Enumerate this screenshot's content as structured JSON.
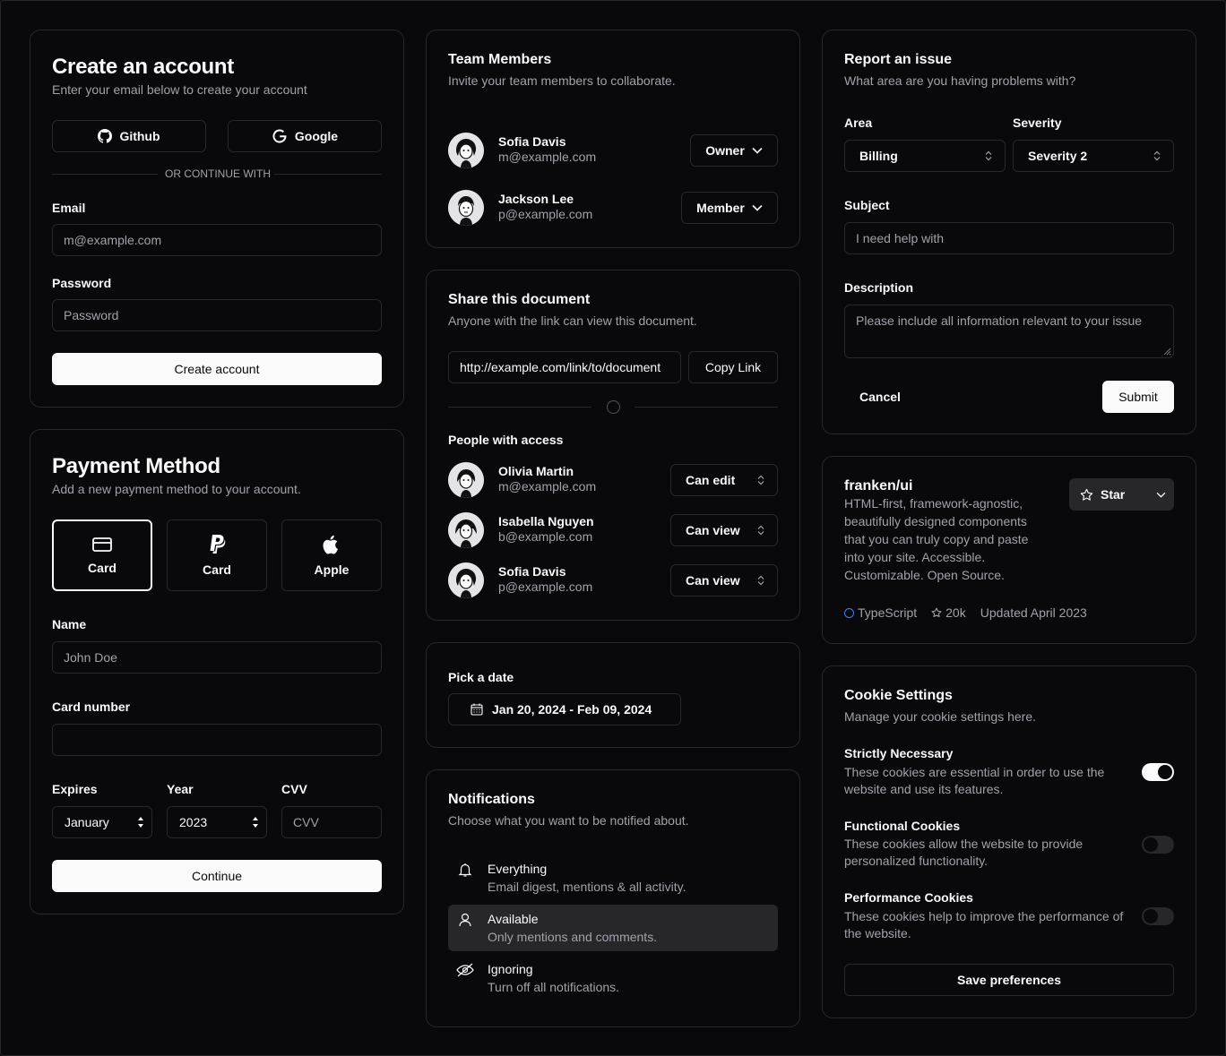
{
  "create_account": {
    "title": "Create an account",
    "subtitle": "Enter your email below to create your account",
    "github_label": "Github",
    "google_label": "Google",
    "divider_text": "OR CONTINUE WITH",
    "email_label": "Email",
    "email_placeholder": "m@example.com",
    "password_label": "Password",
    "password_placeholder": "Password",
    "submit_label": "Create account"
  },
  "payment": {
    "title": "Payment Method",
    "subtitle": "Add a new payment method to your account.",
    "options": [
      {
        "label": "Card",
        "icon": "credit-card-icon",
        "selected": true
      },
      {
        "label": "Card",
        "icon": "paypal-icon",
        "selected": false
      },
      {
        "label": "Apple",
        "icon": "apple-icon",
        "selected": false
      }
    ],
    "name_label": "Name",
    "name_placeholder": "John Doe",
    "card_number_label": "Card number",
    "card_number_placeholder": "",
    "expires_label": "Expires",
    "expires_value": "January",
    "year_label": "Year",
    "year_value": "2023",
    "cvv_label": "CVV",
    "cvv_placeholder": "CVV",
    "continue_label": "Continue"
  },
  "team": {
    "title": "Team Members",
    "subtitle": "Invite your team members to collaborate.",
    "members": [
      {
        "name": "Sofia Davis",
        "email": "m@example.com",
        "role": "Owner"
      },
      {
        "name": "Jackson Lee",
        "email": "p@example.com",
        "role": "Member"
      }
    ]
  },
  "share": {
    "title": "Share this document",
    "subtitle": "Anyone with the link can view this document.",
    "link_value": "http://example.com/link/to/document",
    "copy_label": "Copy Link",
    "people_label": "People with access",
    "people": [
      {
        "name": "Olivia Martin",
        "email": "m@example.com",
        "permission": "Can edit"
      },
      {
        "name": "Isabella Nguyen",
        "email": "b@example.com",
        "permission": "Can view"
      },
      {
        "name": "Sofia Davis",
        "email": "p@example.com",
        "permission": "Can view"
      }
    ]
  },
  "date": {
    "label": "Pick a date",
    "range": "Jan 20, 2024 - Feb 09, 2024"
  },
  "notifications": {
    "title": "Notifications",
    "subtitle": "Choose what you want to be notified about.",
    "items": [
      {
        "title": "Everything",
        "desc": "Email digest, mentions & all activity.",
        "icon": "bell-icon",
        "selected": false
      },
      {
        "title": "Available",
        "desc": "Only mentions and comments.",
        "icon": "user-icon",
        "selected": true
      },
      {
        "title": "Ignoring",
        "desc": "Turn off all notifications.",
        "icon": "eye-off-icon",
        "selected": false
      }
    ]
  },
  "report": {
    "title": "Report an issue",
    "subtitle": "What area are you having problems with?",
    "area_label": "Area",
    "area_value": "Billing",
    "severity_label": "Severity",
    "severity_value": "Severity 2",
    "subject_label": "Subject",
    "subject_placeholder": "I need help with",
    "description_label": "Description",
    "description_placeholder": "Please include all information relevant to your issue",
    "cancel_label": "Cancel",
    "submit_label": "Submit"
  },
  "repo": {
    "name": "franken/ui",
    "description": "HTML-first, framework-agnostic, beautifully designed components that you can truly copy and paste into your site. Accessible. Customizable. Open Source.",
    "star_label": "Star",
    "language": "TypeScript",
    "stars": "20k",
    "updated": "Updated April 2023",
    "language_color": "#3b82f6"
  },
  "cookies": {
    "title": "Cookie Settings",
    "subtitle": "Manage your cookie settings here.",
    "items": [
      {
        "title": "Strictly Necessary",
        "desc": "These cookies are essential in order to use the website and use its features.",
        "enabled": true
      },
      {
        "title": "Functional Cookies",
        "desc": "These cookies allow the website to provide personalized functionality.",
        "enabled": false
      },
      {
        "title": "Performance Cookies",
        "desc": "These cookies help to improve the performance of the website.",
        "enabled": false
      }
    ],
    "save_label": "Save preferences"
  }
}
